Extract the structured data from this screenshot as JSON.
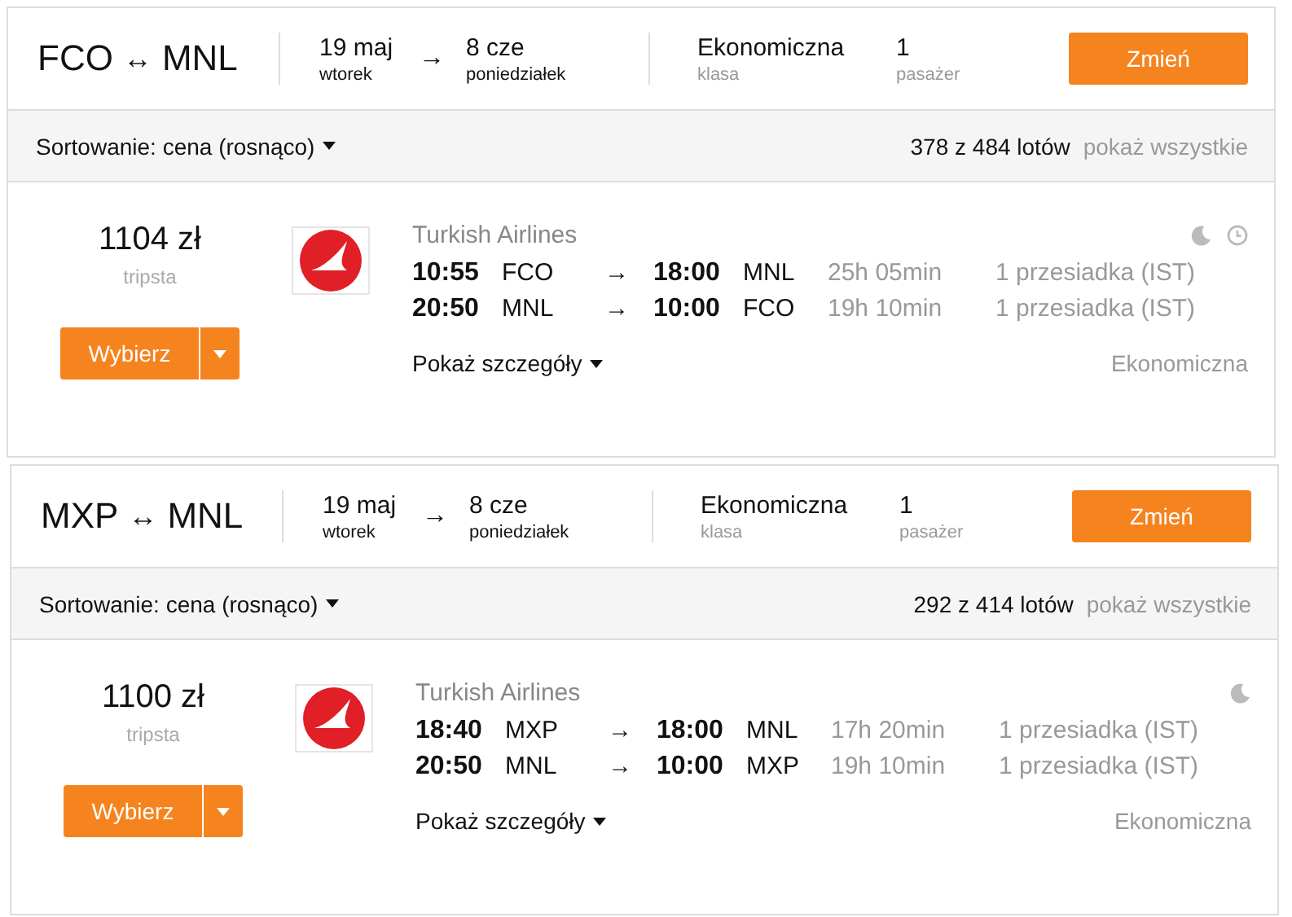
{
  "searches": [
    {
      "route": {
        "from": "FCO",
        "sep": "↔",
        "to": "MNL"
      },
      "depart": {
        "date": "19 maj",
        "day": "wtorek"
      },
      "date_arrow": "→",
      "return": {
        "date": "8 cze",
        "day": "poniedziałek"
      },
      "cabin": {
        "value": "Ekonomiczna",
        "label": "klasa"
      },
      "passengers": {
        "value": "1",
        "label": "pasażer"
      },
      "change_button": "Zmień",
      "sort": {
        "label": "Sortowanie: cena (rosnąco)"
      },
      "count": "378 z 484 lotów",
      "show_all": "pokaż wszystkie",
      "result": {
        "price": "1104 zł",
        "vendor": "tripsta",
        "select_button": "Wybierz",
        "airline": "Turkish Airlines",
        "badges": [
          {
            "kind": "moon"
          },
          {
            "kind": "clock"
          }
        ],
        "legs": [
          {
            "dep_time": "10:55",
            "dep": "FCO",
            "arrow": "→",
            "arr_time": "18:00",
            "arr": "MNL",
            "duration": "25h 05min",
            "stops": "1 przesiadka (IST)"
          },
          {
            "dep_time": "20:50",
            "dep": "MNL",
            "arrow": "→",
            "arr_time": "10:00",
            "arr": "FCO",
            "duration": "19h 10min",
            "stops": "1 przesiadka (IST)"
          }
        ],
        "details_link": "Pokaż szczegóły",
        "cabin": "Ekonomiczna"
      }
    },
    {
      "route": {
        "from": "MXP",
        "sep": "↔",
        "to": "MNL"
      },
      "depart": {
        "date": "19 maj",
        "day": "wtorek"
      },
      "date_arrow": "→",
      "return": {
        "date": "8 cze",
        "day": "poniedziałek"
      },
      "cabin": {
        "value": "Ekonomiczna",
        "label": "klasa"
      },
      "passengers": {
        "value": "1",
        "label": "pasażer"
      },
      "change_button": "Zmień",
      "sort": {
        "label": "Sortowanie: cena (rosnąco)"
      },
      "count": "292 z 414 lotów",
      "show_all": "pokaż wszystkie",
      "result": {
        "price": "1100 zł",
        "vendor": "tripsta",
        "select_button": "Wybierz",
        "airline": "Turkish Airlines",
        "badges": [
          {
            "kind": "moon"
          }
        ],
        "legs": [
          {
            "dep_time": "18:40",
            "dep": "MXP",
            "arrow": "→",
            "arr_time": "18:00",
            "arr": "MNL",
            "duration": "17h 20min",
            "stops": "1 przesiadka (IST)"
          },
          {
            "dep_time": "20:50",
            "dep": "MNL",
            "arrow": "→",
            "arr_time": "10:00",
            "arr": "MXP",
            "duration": "19h 10min",
            "stops": "1 przesiadka (IST)"
          }
        ],
        "details_link": "Pokaż szczegóły",
        "cabin": "Ekonomiczna"
      }
    }
  ]
}
